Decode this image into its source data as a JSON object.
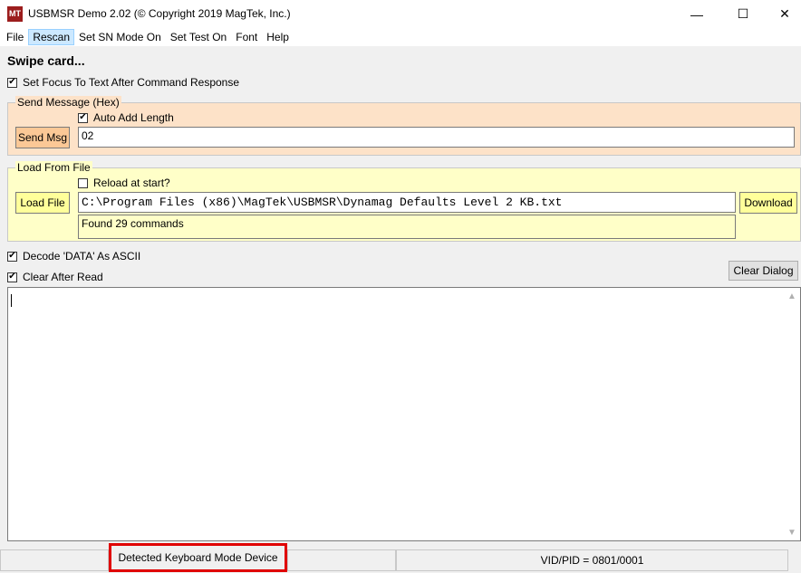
{
  "window": {
    "icon_text": "MT",
    "title": "USBMSR Demo 2.02 (© Copyright 2019 MagTek, Inc.)",
    "minimize": "—",
    "maximize": "☐",
    "close": "✕"
  },
  "menu": {
    "items": [
      "File",
      "Rescan",
      "Set SN Mode On",
      "Set Test On",
      "Font",
      "Help"
    ]
  },
  "status_label": "Swipe card...",
  "options": {
    "set_focus_label": "Set Focus To Text After Command Response",
    "set_focus_checked": true,
    "decode_label": "Decode 'DATA' As ASCII",
    "decode_checked": true,
    "clear_after_label": "Clear After Read",
    "clear_after_checked": true
  },
  "send_message": {
    "legend": "Send Message (Hex)",
    "auto_add_label": "Auto Add Length",
    "auto_add_checked": true,
    "button": "Send Msg",
    "value": "02",
    "color": "#fde2c8"
  },
  "load_file": {
    "legend": "Load From File",
    "reload_label": "Reload at start?",
    "reload_checked": false,
    "button": "Load File",
    "path": "C:\\Program Files (x86)\\MagTek\\USBMSR\\Dynamag Defaults Level 2 KB.txt",
    "result": "Found 29 commands",
    "download_button": "Download",
    "color": "#ffffc8"
  },
  "clear_dialog_button": "Clear Dialog",
  "output_text": "",
  "statusbar": {
    "left": "Detected Keyboard Mode Device",
    "right": "VID/PID = 0801/0001",
    "highlight_color": "#e00000"
  }
}
